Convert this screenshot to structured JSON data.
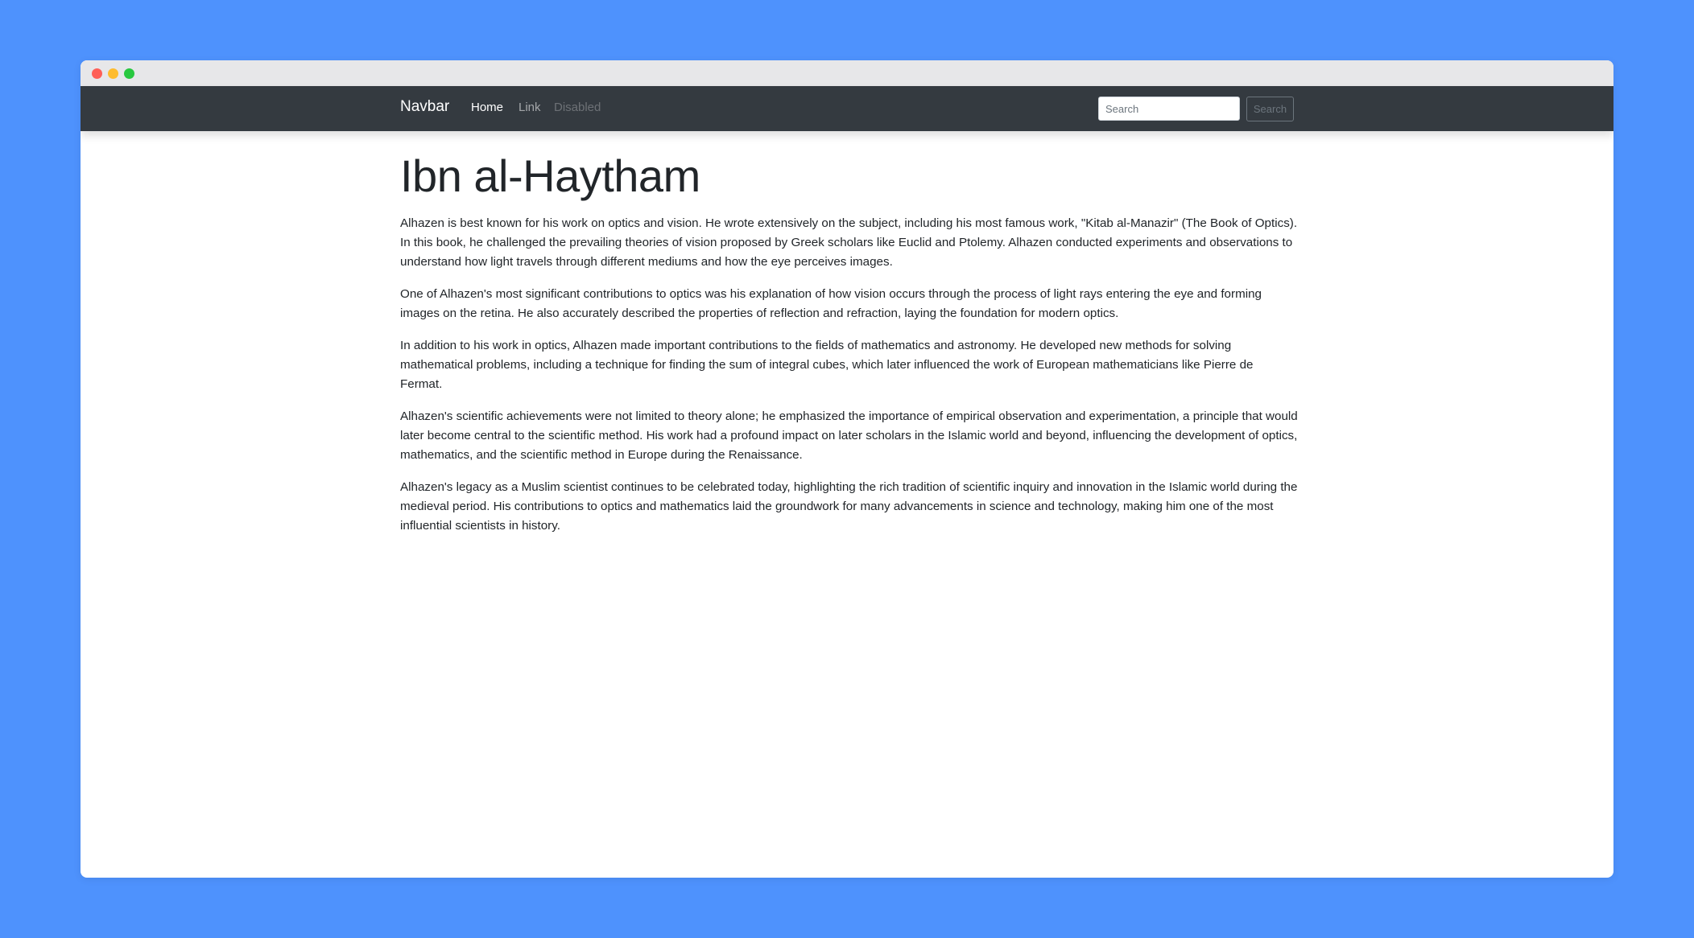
{
  "navbar": {
    "brand": "Navbar",
    "links": [
      {
        "label": "Home",
        "state": "active"
      },
      {
        "label": "Link",
        "state": "normal"
      },
      {
        "label": "Disabled",
        "state": "disabled"
      }
    ],
    "search": {
      "placeholder": "Search",
      "value": "",
      "button_label": "Search"
    }
  },
  "main": {
    "title": "Ibn al-Haytham",
    "paragraphs": [
      "Alhazen is best known for his work on optics and vision. He wrote extensively on the subject, including his most famous work, \"Kitab al-Manazir\" (The Book of Optics). In this book, he challenged the prevailing theories of vision proposed by Greek scholars like Euclid and Ptolemy. Alhazen conducted experiments and observations to understand how light travels through different mediums and how the eye perceives images.",
      "One of Alhazen's most significant contributions to optics was his explanation of how vision occurs through the process of light rays entering the eye and forming images on the retina. He also accurately described the properties of reflection and refraction, laying the foundation for modern optics.",
      "In addition to his work in optics, Alhazen made important contributions to the fields of mathematics and astronomy. He developed new methods for solving mathematical problems, including a technique for finding the sum of integral cubes, which later influenced the work of European mathematicians like Pierre de Fermat.",
      "Alhazen's scientific achievements were not limited to theory alone; he emphasized the importance of empirical observation and experimentation, a principle that would later become central to the scientific method. His work had a profound impact on later scholars in the Islamic world and beyond, influencing the development of optics, mathematics, and the scientific method in Europe during the Renaissance.",
      "Alhazen's legacy as a Muslim scientist continues to be celebrated today, highlighting the rich tradition of scientific inquiry and innovation in the Islamic world during the medieval period. His contributions to optics and mathematics laid the groundwork for many advancements in science and technology, making him one of the most influential scientists in history."
    ]
  },
  "colors": {
    "background": "#4e92fd",
    "navbar": "#343a40",
    "titlebar": "#e7e7e9",
    "window_close": "#fe5f57",
    "window_minimize": "#febc2e",
    "window_maximize": "#28c840"
  }
}
